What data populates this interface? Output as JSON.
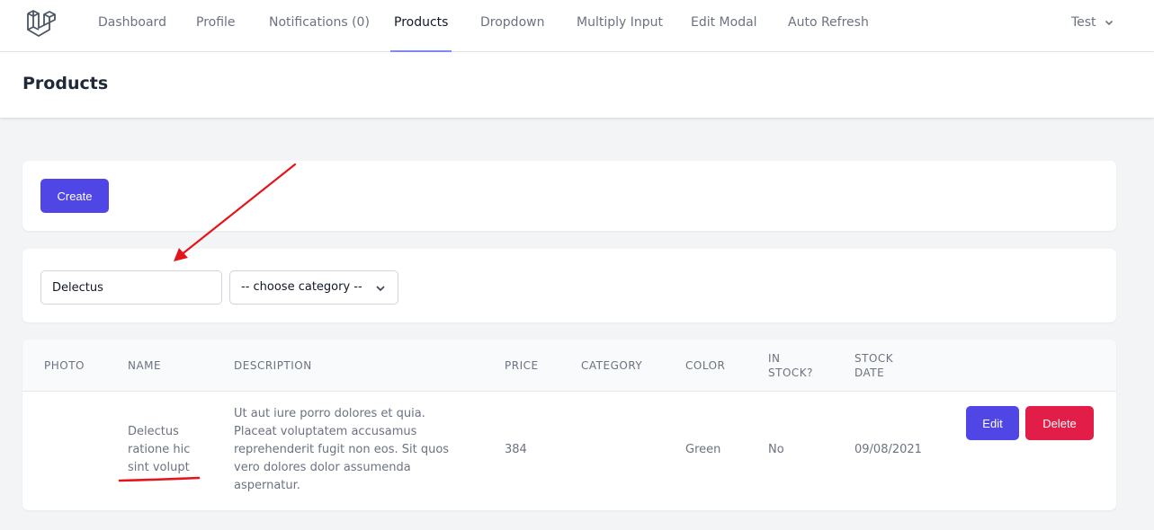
{
  "nav": {
    "items": [
      {
        "label": "Dashboard"
      },
      {
        "label": "Profile"
      },
      {
        "label": "Notifications (0)"
      },
      {
        "label": "Products"
      },
      {
        "label": "Dropdown"
      },
      {
        "label": "Multiply Input"
      },
      {
        "label": "Edit Modal"
      },
      {
        "label": "Auto Refresh"
      }
    ],
    "active": "Products",
    "user": "Test",
    "logo_icon": "laravel-logo-icon"
  },
  "header": {
    "title": "Products"
  },
  "actions": {
    "create_label": "Create"
  },
  "filters": {
    "search_value": "Delectus",
    "category_selected": "-- choose category --",
    "dropdown_icon": "chevron-down-icon"
  },
  "table": {
    "headers": {
      "photo": "PHOTO",
      "name": "NAME",
      "description": "DESCRIPTION",
      "price": "PRICE",
      "category": "CATEGORY",
      "color": "COLOR",
      "in_stock_1": "IN",
      "in_stock_2": "STOCK?",
      "stock_date_1": "STOCK",
      "stock_date_2": "DATE"
    },
    "rows": [
      {
        "photo": "",
        "name_lines": [
          "Delectus",
          "ratione hic",
          "sint volupt"
        ],
        "description_lines": [
          "Ut aut iure porro dolores et quia.",
          "Placeat voluptatem accusamus",
          "reprehenderit fugit non eos. Sit quos",
          "vero dolores dolor assumenda",
          "aspernatur."
        ],
        "price": "384",
        "category": "",
        "color": "Green",
        "in_stock": "No",
        "stock_date": "09/08/2021",
        "edit_label": "Edit",
        "delete_label": "Delete"
      }
    ]
  },
  "colors": {
    "primary": "#4f46e5",
    "danger": "#e11d48",
    "annotation": "#e5141b",
    "logo": "#4b5563"
  }
}
